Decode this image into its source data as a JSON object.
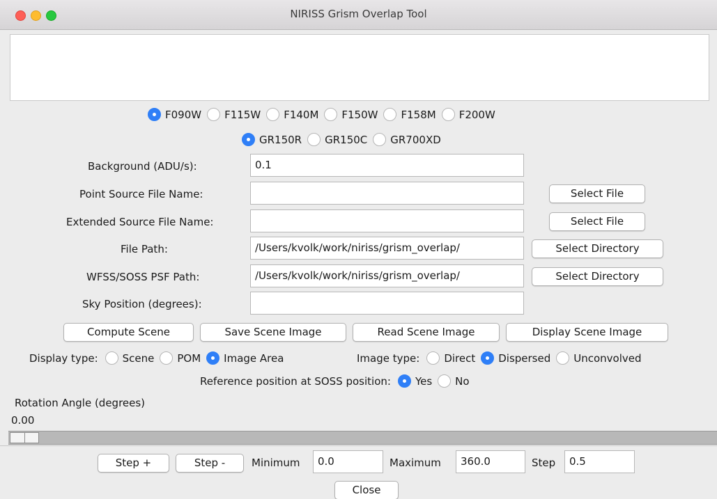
{
  "window": {
    "title": "NIRISS Grism Overlap Tool"
  },
  "filters": [
    {
      "label": "F090W",
      "selected": true
    },
    {
      "label": "F115W",
      "selected": false
    },
    {
      "label": "F140M",
      "selected": false
    },
    {
      "label": "F150W",
      "selected": false
    },
    {
      "label": "F158M",
      "selected": false
    },
    {
      "label": "F200W",
      "selected": false
    }
  ],
  "grisms": [
    {
      "label": "GR150R",
      "selected": true
    },
    {
      "label": "GR150C",
      "selected": false
    },
    {
      "label": "GR700XD",
      "selected": false
    }
  ],
  "form": {
    "background_label": "Background (ADU/s):",
    "background_value": "0.1",
    "point_source_label": "Point Source File Name:",
    "point_source_value": "",
    "extended_source_label": "Extended Source File Name:",
    "extended_source_value": "",
    "file_path_label": "File Path:",
    "file_path_value": "/Users/kvolk/work/niriss/grism_overlap/",
    "psf_path_label": "WFSS/SOSS PSF Path:",
    "psf_path_value": "/Users/kvolk/work/niriss/grism_overlap/",
    "sky_position_label": "Sky Position (degrees):",
    "sky_position_value": "",
    "select_file_label": "Select File",
    "select_directory_label": "Select Directory"
  },
  "actions": {
    "compute": "Compute Scene",
    "save": "Save Scene Image",
    "read": "Read Scene Image",
    "display": "Display Scene Image"
  },
  "display_type": {
    "label": "Display type:",
    "options": [
      {
        "label": "Scene",
        "selected": false
      },
      {
        "label": "POM",
        "selected": false
      },
      {
        "label": "Image Area",
        "selected": true
      }
    ]
  },
  "image_type": {
    "label": "Image type:",
    "options": [
      {
        "label": "Direct",
        "selected": false
      },
      {
        "label": "Dispersed",
        "selected": true
      },
      {
        "label": "Unconvolved",
        "selected": false
      }
    ]
  },
  "reference": {
    "label": "Reference position at SOSS position:",
    "options": [
      {
        "label": "Yes",
        "selected": true
      },
      {
        "label": "No",
        "selected": false
      }
    ]
  },
  "rotation": {
    "label": "Rotation Angle (degrees)",
    "value": "0.00",
    "slider_fraction": 0.0
  },
  "step_controls": {
    "step_plus": "Step +",
    "step_minus": "Step -",
    "minimum_label": "Minimum",
    "minimum_value": "0.0",
    "maximum_label": "Maximum",
    "maximum_value": "360.0",
    "step_label": "Step",
    "step_value": "0.5"
  },
  "close_label": "Close",
  "colors": {
    "accent": "#2f7ff7",
    "window_bg": "#ececec"
  }
}
